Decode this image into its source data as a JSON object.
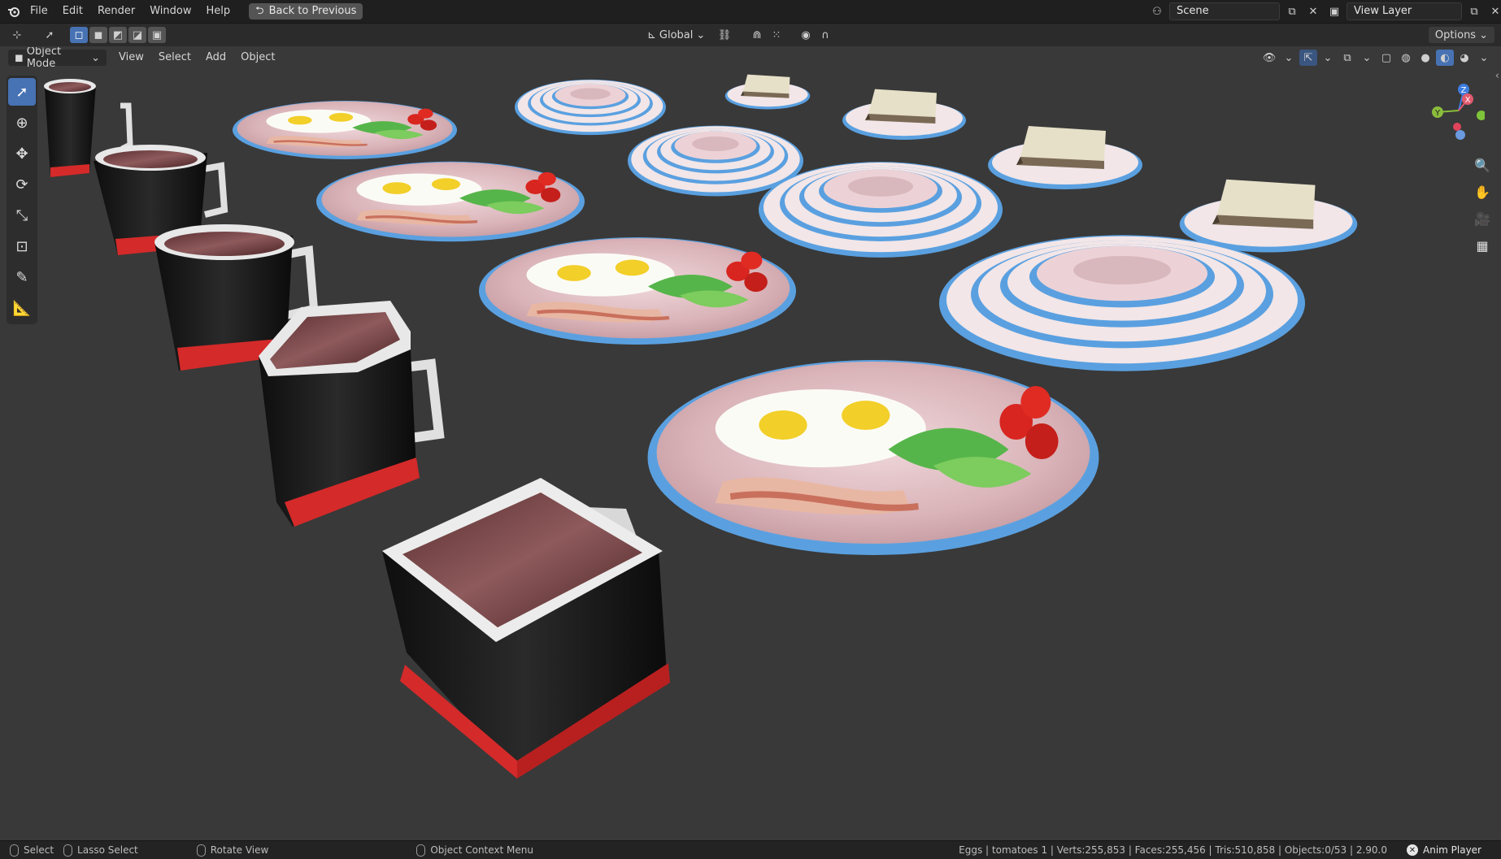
{
  "topbar": {
    "app_icon": "blender-logo-icon",
    "menu": [
      "File",
      "Edit",
      "Render",
      "Window",
      "Help"
    ],
    "back_button": "Back to Previous",
    "scene_label": "Scene",
    "view_layer_label": "View Layer"
  },
  "toolheader": {
    "transform_orientation": "Global",
    "options_label": "Options"
  },
  "viewheader": {
    "mode": "Object Mode",
    "menus": [
      "View",
      "Select",
      "Add",
      "Object"
    ]
  },
  "toolbar": {
    "tools": [
      "select-box-icon",
      "cursor-icon",
      "move-icon",
      "rotate-icon",
      "scale-icon",
      "transform-icon",
      "annotate-icon",
      "measure-icon"
    ]
  },
  "navigation": {
    "buttons": [
      "zoom-icon",
      "pan-hand-icon",
      "camera-view-icon",
      "ortho-grid-icon"
    ],
    "gizmo_axes": [
      "X",
      "Y",
      "Z"
    ]
  },
  "statusbar": {
    "select": "Select",
    "lasso_select": "Lasso Select",
    "rotate_view": "Rotate View",
    "context_menu": "Object Context Menu",
    "stats": "Eggs | tomatoes 1 | Verts:255,853 | Faces:255,456 | Tris:510,858 | Objects:0/53 | 2.90.0",
    "anim_player": "Anim Player"
  },
  "colors": {
    "accent": "#4772b3",
    "viewport_bg": "#393939",
    "mug_band": "#d42a2a",
    "plate_rim": "#5aa0e0",
    "plate_face": "#e8c9cc"
  }
}
